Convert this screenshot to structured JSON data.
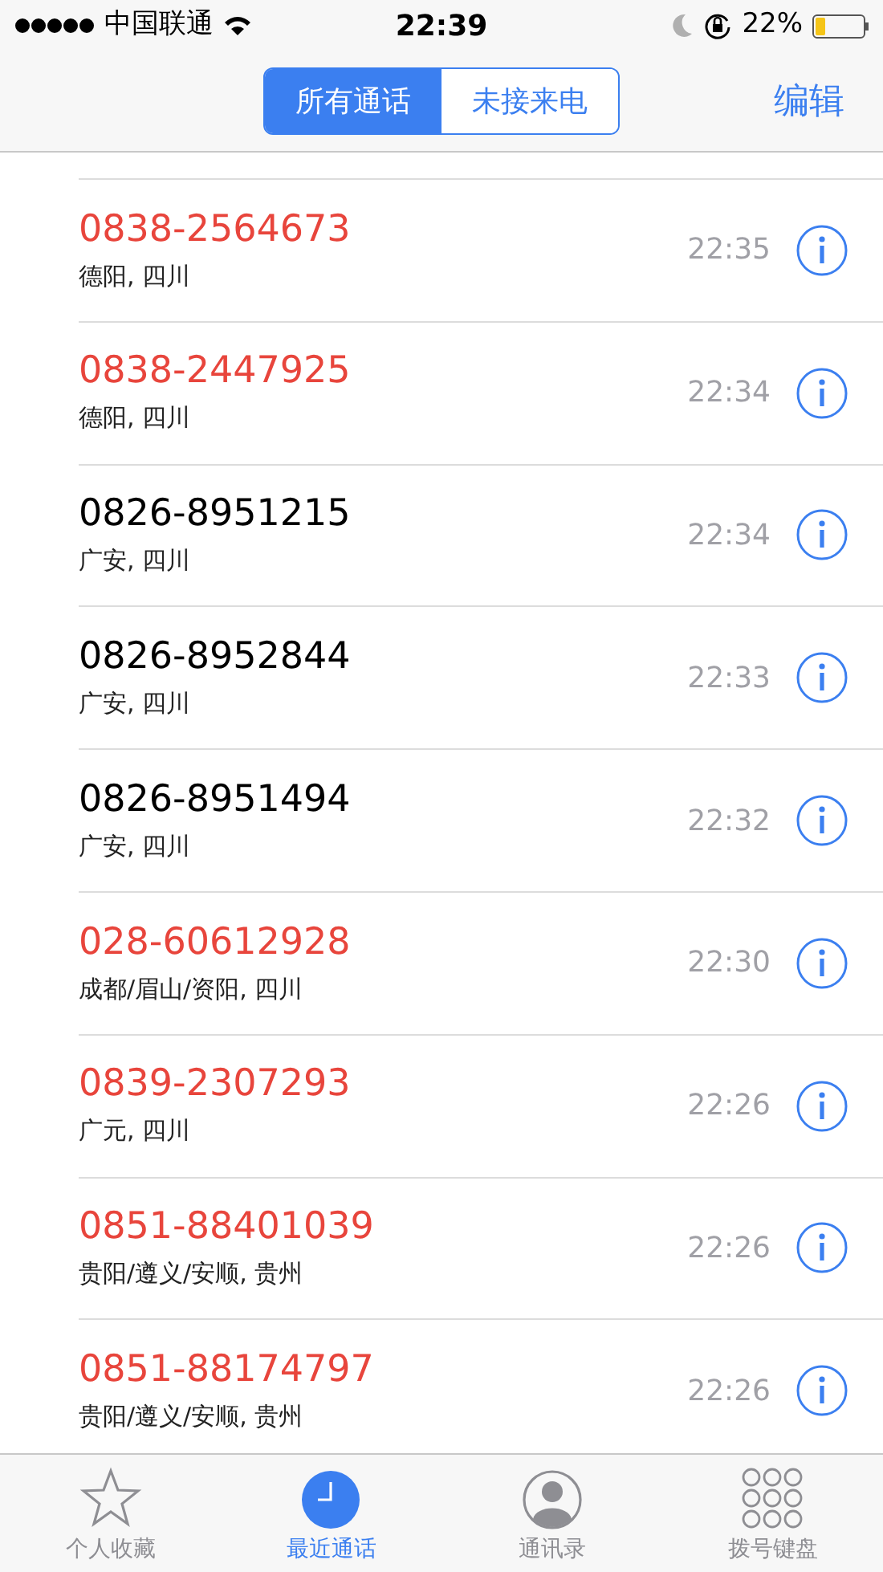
{
  "status_bar": {
    "carrier": "中国联通",
    "time": "22:39",
    "battery_text": "22%",
    "battery": {
      "level": 0.22
    }
  },
  "segments": [
    {
      "label": "所有通话",
      "selected": true
    },
    {
      "label": "未接来电",
      "selected": false
    }
  ],
  "edit_button": "编辑",
  "calls": [
    {
      "number": "0838-2564673",
      "location": "德阳, 四川",
      "time": "22:35",
      "missed": true
    },
    {
      "number": "0838-2447925",
      "location": "德阳, 四川",
      "time": "22:34",
      "missed": true
    },
    {
      "number": "0826-8951215",
      "location": "广安, 四川",
      "time": "22:34",
      "missed": false
    },
    {
      "number": "0826-8952844",
      "location": "广安, 四川",
      "time": "22:33",
      "missed": false
    },
    {
      "number": "0826-8951494",
      "location": "广安, 四川",
      "time": "22:32",
      "missed": false
    },
    {
      "number": "028-60612928",
      "location": "成都/眉山/资阳, 四川",
      "time": "22:30",
      "missed": true
    },
    {
      "number": "0839-2307293",
      "location": "广元, 四川",
      "time": "22:26",
      "missed": true
    },
    {
      "number": "0851-88401039",
      "location": "贵阳/遵义/安顺, 贵州",
      "time": "22:26",
      "missed": true
    },
    {
      "number": "0851-88174797",
      "location": "贵阳/遵义/安顺, 贵州",
      "time": "22:26",
      "missed": true
    }
  ],
  "tab_bar": [
    {
      "kind": "star",
      "label": "个人收藏",
      "selected": false
    },
    {
      "kind": "clock",
      "label": "最近通话",
      "selected": true
    },
    {
      "kind": "person",
      "label": "通讯录",
      "selected": false
    },
    {
      "kind": "keypad",
      "label": "拨号键盘",
      "selected": false
    }
  ]
}
